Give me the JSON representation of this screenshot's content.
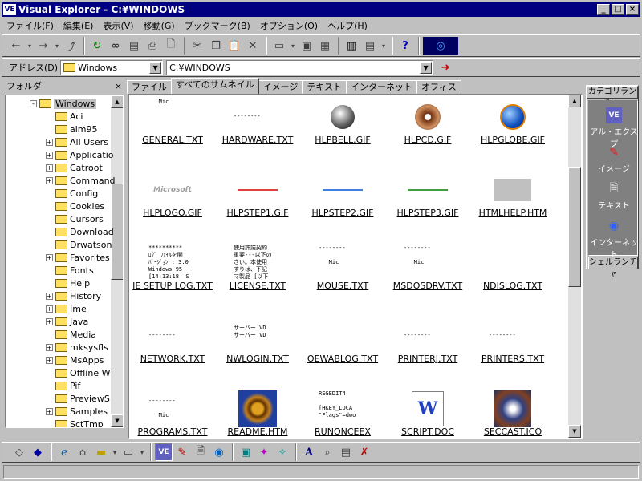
{
  "window": {
    "title": "Visual Explorer - C:¥WINDOWS",
    "app_icon_label": "VE"
  },
  "menu": [
    "ファイル(F)",
    "編集(E)",
    "表示(V)",
    "移動(G)",
    "ブックマーク(B)",
    "オプション(O)",
    "ヘルプ(H)"
  ],
  "address": {
    "label": "アドレス(D)",
    "folder": "Windows",
    "path": "C:¥WINDOWS"
  },
  "folder_pane": {
    "title": "フォルダ",
    "items": [
      {
        "label": "Windows",
        "expand": "-",
        "indent": 0
      },
      {
        "label": "Aci",
        "expand": "",
        "indent": 1
      },
      {
        "label": "aim95",
        "expand": "",
        "indent": 1
      },
      {
        "label": "All Users",
        "expand": "+",
        "indent": 1
      },
      {
        "label": "Applicatio",
        "expand": "+",
        "indent": 1
      },
      {
        "label": "Catroot",
        "expand": "+",
        "indent": 1
      },
      {
        "label": "Command",
        "expand": "+",
        "indent": 1
      },
      {
        "label": "Config",
        "expand": "",
        "indent": 1
      },
      {
        "label": "Cookies",
        "expand": "",
        "indent": 1
      },
      {
        "label": "Cursors",
        "expand": "",
        "indent": 1
      },
      {
        "label": "Download",
        "expand": "",
        "indent": 1
      },
      {
        "label": "Drwatson",
        "expand": "",
        "indent": 1
      },
      {
        "label": "Favorites",
        "expand": "+",
        "indent": 1
      },
      {
        "label": "Fonts",
        "expand": "",
        "indent": 1
      },
      {
        "label": "Help",
        "expand": "",
        "indent": 1
      },
      {
        "label": "History",
        "expand": "+",
        "indent": 1
      },
      {
        "label": "Ime",
        "expand": "+",
        "indent": 1
      },
      {
        "label": "Java",
        "expand": "+",
        "indent": 1
      },
      {
        "label": "Media",
        "expand": "",
        "indent": 1
      },
      {
        "label": "mksysfls",
        "expand": "+",
        "indent": 1
      },
      {
        "label": "MsApps",
        "expand": "+",
        "indent": 1
      },
      {
        "label": "Offline W",
        "expand": "",
        "indent": 1
      },
      {
        "label": "Pif",
        "expand": "",
        "indent": 1
      },
      {
        "label": "PreviewS",
        "expand": "",
        "indent": 1
      },
      {
        "label": "Samples",
        "expand": "+",
        "indent": 1
      },
      {
        "label": "SctTmp",
        "expand": "",
        "indent": 1
      }
    ]
  },
  "tabs": [
    "ファイル",
    "すべてのサムネイル",
    "イメージ",
    "テキスト",
    "インターネット",
    "オフィス"
  ],
  "active_tab": 1,
  "thumbnails": [
    {
      "name": "GENERAL.TXT",
      "kind": "text",
      "preview": "   Mic"
    },
    {
      "name": "HARDWARE.TXT",
      "kind": "text",
      "preview": "\n\n--------"
    },
    {
      "name": "HLPBELL.GIF",
      "kind": "bell",
      "preview": ""
    },
    {
      "name": "HLPCD.GIF",
      "kind": "cd",
      "preview": ""
    },
    {
      "name": "HLPGLOBE.GIF",
      "kind": "globe",
      "preview": ""
    },
    {
      "name": "HLPLOGO.GIF",
      "kind": "mslogo",
      "preview": "Microsoft"
    },
    {
      "name": "HLPSTEP1.GIF",
      "kind": "line-red",
      "preview": ""
    },
    {
      "name": "HLPSTEP2.GIF",
      "kind": "line-blue",
      "preview": ""
    },
    {
      "name": "HLPSTEP3.GIF",
      "kind": "line-green",
      "preview": ""
    },
    {
      "name": "HTMLHELP.HTM",
      "kind": "grey",
      "preview": ""
    },
    {
      "name": "IE SETUP LOG.TXT",
      "kind": "text",
      "preview": "**********\nﾛｸﾞ ﾌｧｲﾙを開\nﾊﾞｰｼﾞｮﾝ : 3.0\nWindows 95\n[14:13:18  S"
    },
    {
      "name": "LICENSE.TXT",
      "kind": "text",
      "preview": "使用許諾契約\n重要---以下の\nさい。本使用\nすりは、下記\nマ製品 [以下"
    },
    {
      "name": "MOUSE.TXT",
      "kind": "text",
      "preview": "--------\n\n   Mic"
    },
    {
      "name": "MSDOSDRV.TXT",
      "kind": "text",
      "preview": "--------\n\n   Mic"
    },
    {
      "name": "NDISLOG.TXT",
      "kind": "text",
      "preview": ""
    },
    {
      "name": "NETWORK.TXT",
      "kind": "text",
      "preview": "\n\n--------\n\n\n--------"
    },
    {
      "name": "NWLOGIN.TXT",
      "kind": "text",
      "preview": "\nサーバー VD\nサーバー VD\n\n\nドライブ A: (\nドライブ B: ("
    },
    {
      "name": "OEWABLOG.TXT",
      "kind": "text",
      "preview": "\n\n\n\n\n-----[STAF"
    },
    {
      "name": "PRINTERJ.TXT",
      "kind": "text",
      "preview": "\n\n--------\n\n\n--------"
    },
    {
      "name": "PRINTERS.TXT",
      "kind": "text",
      "preview": "\n\n--------\n\n\n--------"
    },
    {
      "name": "PROGRAMS.TXT",
      "kind": "text",
      "preview": "\n--------\n\n   Mic"
    },
    {
      "name": "README.HTM",
      "kind": "wheel",
      "preview": ""
    },
    {
      "name": "RUNONCEEX",
      "kind": "text",
      "preview": "REGEDIT4\n\n[HKEY_LOCA\n\"Flags\"=dwo"
    },
    {
      "name": "SCRIPT.DOC",
      "kind": "worddoc",
      "preview": "W"
    },
    {
      "name": "SECCAST.ICO",
      "kind": "seccast",
      "preview": ""
    }
  ],
  "category_bar": {
    "title": "カテゴリランチャ",
    "items": [
      "アル・エクスプ",
      "イメージ",
      "テキスト",
      "インターネット"
    ],
    "footer": "シェルランチャ"
  },
  "colors": {
    "title_bg": "#000080",
    "face": "#c0c0c0",
    "shadow": "#808080"
  }
}
